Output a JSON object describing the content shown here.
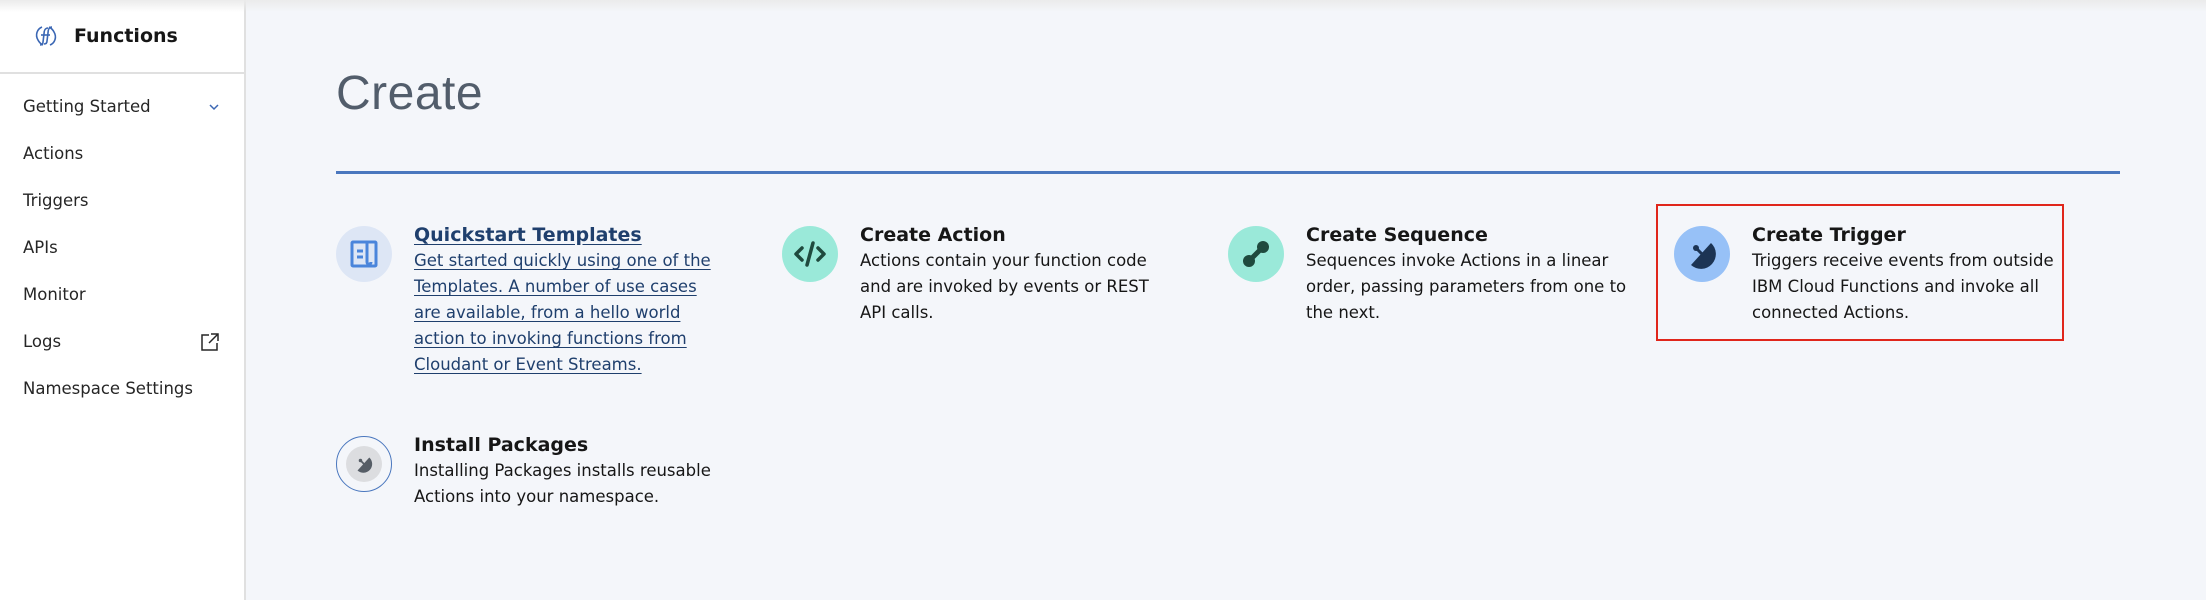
{
  "app": {
    "title": "Functions",
    "logo_icon": "functions-logo-icon"
  },
  "sidebar": {
    "items": [
      {
        "label": "Getting Started",
        "icon": "chevron-down-icon"
      },
      {
        "label": "Actions"
      },
      {
        "label": "Triggers"
      },
      {
        "label": "APIs"
      },
      {
        "label": "Monitor"
      },
      {
        "label": "Logs",
        "icon": "external-link-icon"
      },
      {
        "label": "Namespace Settings"
      }
    ]
  },
  "main": {
    "title": "Create",
    "tiles": [
      {
        "title": "Quickstart Templates",
        "description": "Get started quickly using one of the Templates. A number of use cases are available, from a hello world action to invoking functions from Cloudant or Event Streams.",
        "icon": "template-book-icon",
        "link": true
      },
      {
        "title": "Create Action",
        "description": "Actions contain your function code and are invoked by events or REST API calls.",
        "icon": "code-icon"
      },
      {
        "title": "Create Sequence",
        "description": "Sequences invoke Actions in a linear order, passing parameters from one to the next.",
        "icon": "sequence-icon"
      },
      {
        "title": "Create Trigger",
        "description": "Triggers receive events from outside IBM Cloud Functions and invoke all connected Actions.",
        "icon": "trigger-dish-icon",
        "highlighted": true
      },
      {
        "title": "Install Packages",
        "description": "Installing Packages installs reusable Actions into your namespace.",
        "icon": "package-icon"
      }
    ]
  },
  "colors": {
    "accent": "#4a77be",
    "link": "#1f3f6d",
    "highlight_border": "#e0261b",
    "teal_icon_bg": "#9ae9d9",
    "blue_icon_bg": "#97c1f7",
    "template_icon_bg": "#dde6f5"
  }
}
